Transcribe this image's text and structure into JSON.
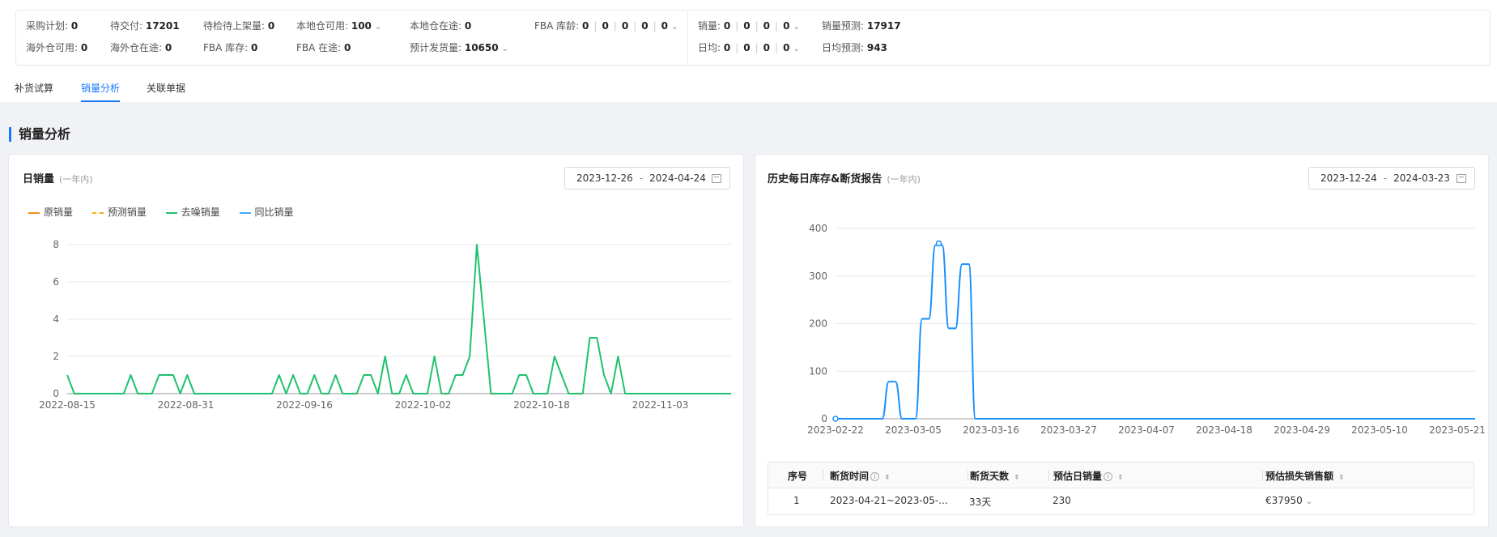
{
  "stats": {
    "row1": [
      {
        "label": "采购计划: ",
        "value": "0"
      },
      {
        "label": "待交付: ",
        "value": "17201"
      },
      {
        "label": "待检待上架量: ",
        "value": "0"
      },
      {
        "label": "本地仓可用: ",
        "value": "100"
      },
      {
        "label": "本地仓在途: ",
        "value": "0"
      },
      {
        "label": "FBA 库龄: ",
        "values": [
          "0",
          "0",
          "0",
          "0",
          "0"
        ]
      }
    ],
    "row2": [
      {
        "label": "海外仓可用: ",
        "value": "0"
      },
      {
        "label": "海外仓在途: ",
        "value": "0"
      },
      {
        "label": "FBA 库存: ",
        "value": "0"
      },
      {
        "label": "FBA 在途: ",
        "value": "0"
      },
      {
        "label": "预计发货量: ",
        "value": "10650"
      }
    ],
    "right_row1": [
      {
        "label": "销量: ",
        "values": [
          "0",
          "0",
          "0",
          "0"
        ]
      },
      {
        "label": "销量预测: ",
        "value": "17917"
      }
    ],
    "right_row2": [
      {
        "label": "日均: ",
        "values": [
          "0",
          "0",
          "0",
          "0"
        ]
      },
      {
        "label": "日均预测: ",
        "value": "943"
      }
    ]
  },
  "tabs": [
    {
      "label": "补货试算",
      "active": false
    },
    {
      "label": "销量分析",
      "active": true
    },
    {
      "label": "关联单据",
      "active": false
    }
  ],
  "section_title": "销量分析",
  "left_card": {
    "title": "日销量",
    "subtitle": "(一年内)",
    "date_start": "2023-12-26",
    "date_sep": "-",
    "date_end": "2024-04-24",
    "legend": [
      {
        "label": "原销量",
        "color": "#fa8c16",
        "dashed": false
      },
      {
        "label": "预测销量",
        "color": "#faad14",
        "dashed": true
      },
      {
        "label": "去噪销量",
        "color": "#1ec26e",
        "dashed": false
      },
      {
        "label": "同比销量",
        "color": "#40a9ff",
        "dashed": false
      }
    ]
  },
  "right_card": {
    "title": "历史每日库存&断货报告",
    "subtitle": "(一年内)",
    "date_start": "2023-12-24",
    "date_sep": "-",
    "date_end": "2024-03-23"
  },
  "chart_data": [
    {
      "type": "line",
      "title": "日销量",
      "series_name": "去噪销量",
      "color": "#1ec26e",
      "x_ticks": [
        "2022-08-15",
        "2022-08-31",
        "2022-09-16",
        "2022-10-02",
        "2022-10-18",
        "2022-11-03"
      ],
      "y_ticks": [
        0,
        2,
        4,
        6,
        8
      ],
      "ylim": [
        0,
        8
      ],
      "x_start": "2022-08-15",
      "values": [
        1,
        0,
        0,
        0,
        0,
        0,
        0,
        0,
        0,
        1,
        0,
        0,
        0,
        1,
        1,
        1,
        0,
        1,
        0,
        0,
        0,
        0,
        0,
        0,
        0,
        0,
        0,
        0,
        0,
        0,
        1,
        0,
        1,
        0,
        0,
        1,
        0,
        0,
        1,
        0,
        0,
        0,
        1,
        1,
        0,
        2,
        0,
        0,
        1,
        0,
        0,
        0,
        2,
        0,
        0,
        1,
        1,
        2,
        8,
        4,
        0,
        0,
        0,
        0,
        1,
        1,
        0,
        0,
        0,
        2,
        1,
        0,
        0,
        0,
        3,
        3,
        1,
        0,
        2,
        0,
        0,
        0,
        0,
        0,
        0,
        0,
        0,
        0,
        0,
        0,
        0,
        0,
        0,
        0,
        0
      ]
    },
    {
      "type": "line",
      "title": "历史每日库存&断货报告",
      "color": "#1890ff",
      "x_ticks": [
        "2023-02-22",
        "2023-03-05",
        "2023-03-16",
        "2023-03-27",
        "2023-04-07",
        "2023-04-18",
        "2023-04-29",
        "2023-05-10",
        "2023-05-21"
      ],
      "y_ticks": [
        0,
        100,
        200,
        300,
        400
      ],
      "ylim": [
        0,
        400
      ],
      "x_start": "2023-02-22",
      "values": [
        0,
        0,
        0,
        0,
        0,
        0,
        0,
        0,
        78,
        78,
        0,
        0,
        0,
        210,
        210,
        365,
        365,
        190,
        190,
        325,
        325,
        0,
        0,
        0,
        0,
        0,
        0,
        0,
        0,
        0,
        0,
        0,
        0,
        0,
        0,
        0,
        0,
        0,
        0,
        0,
        0,
        0,
        0,
        0,
        0,
        0,
        0,
        0,
        0,
        0,
        0,
        0,
        0,
        0,
        0,
        0,
        0,
        0,
        0,
        0,
        0,
        0,
        0,
        0,
        0,
        0,
        0,
        0,
        0,
        0,
        0,
        0,
        0,
        0,
        0,
        0,
        0,
        0,
        0,
        0,
        0,
        0,
        0,
        0,
        0,
        0,
        0,
        0,
        0,
        0,
        0,
        0,
        0,
        0,
        0,
        0,
        0
      ]
    }
  ],
  "table": {
    "headers": [
      "序号",
      "断货时间",
      "断货天数",
      "预估日销量",
      "预估损失销售额"
    ],
    "rows": [
      {
        "index": "1",
        "time": "2023-04-21~2023-05-...",
        "days": "33天",
        "daily": "230",
        "loss": "€37950"
      }
    ]
  }
}
